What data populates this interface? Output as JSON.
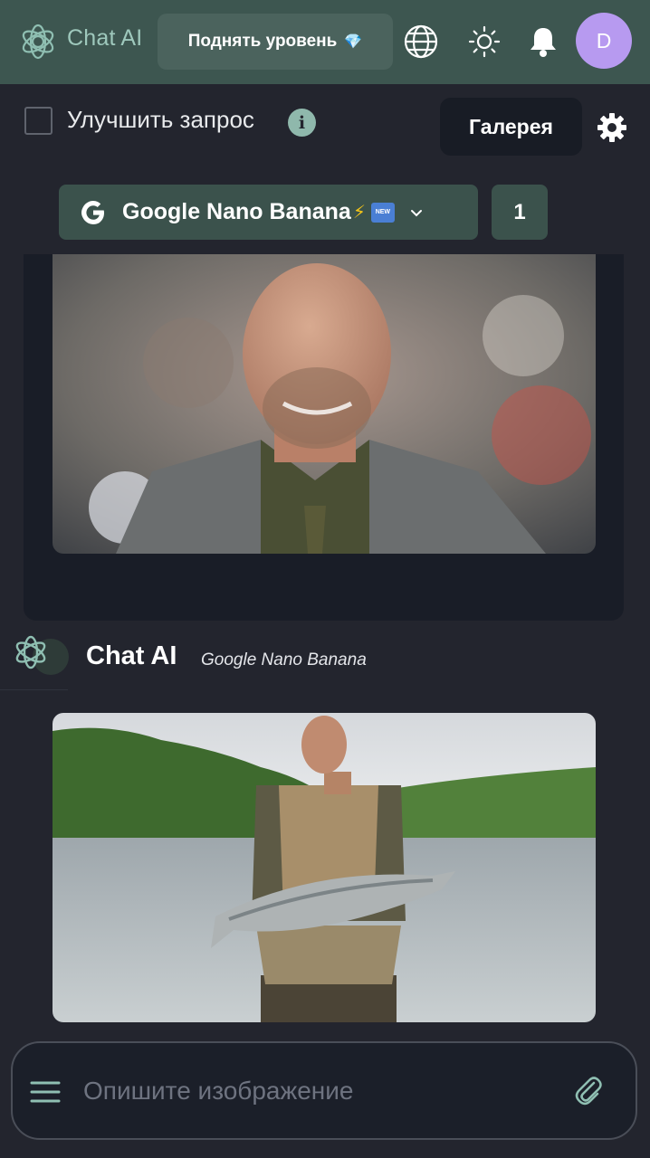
{
  "header": {
    "brand": "Chat AI",
    "upgrade_label": "Поднять уровень",
    "upgrade_icon": "💎",
    "avatar_letter": "D",
    "icons": [
      "globe-icon",
      "sun-icon",
      "bell-icon"
    ]
  },
  "toolbar": {
    "improve_label": "Улучшить запрос",
    "info_glyph": "i",
    "gallery_label": "Галерея"
  },
  "model_selector": {
    "name": "Google Nano Banana",
    "emoji_bolt": "⚡",
    "badge": "NEW",
    "count": "1"
  },
  "assistant": {
    "name": "Chat AI",
    "model": "Google Nano Banana"
  },
  "images": [
    {
      "id": "portrait",
      "subject": "bald smiling man in grey suit"
    },
    {
      "id": "fisher",
      "subject": "man holding large fish at lake"
    }
  ],
  "input": {
    "placeholder": "Опишите изображение"
  },
  "colors": {
    "header_bg": "#3d5650",
    "page_bg": "#23252e",
    "accent": "#8fb8ac",
    "avatar": "#b79af0",
    "model_bg": "#3b524c"
  }
}
